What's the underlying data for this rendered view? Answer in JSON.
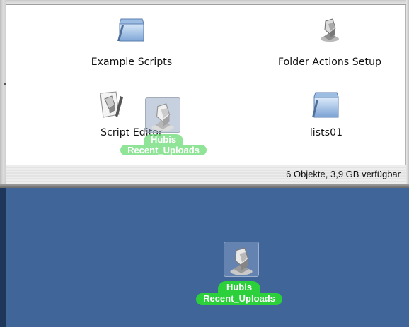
{
  "finder_window": {
    "status_text": "6 Objekte, 3,9 GB verfügbar",
    "items": [
      {
        "label": "Example Scripts",
        "icon": "folder-icon"
      },
      {
        "label": "Folder Actions Setup",
        "icon": "applescript-app-icon"
      },
      {
        "label": "Script Editor",
        "icon": "script-editor-icon"
      },
      {
        "label": "lists01",
        "icon": "folder-icon"
      }
    ]
  },
  "drag_ghost": {
    "label_line1": "Hubis",
    "label_line2": "Recent_Uploads",
    "icon": "applescript-app-icon"
  },
  "desktop": {
    "background_color": "#3f6599",
    "item": {
      "label_line1": "Hubis",
      "label_line2": "Recent_Uploads",
      "icon": "applescript-app-icon",
      "label_highlight_color": "#2bd03b"
    }
  }
}
